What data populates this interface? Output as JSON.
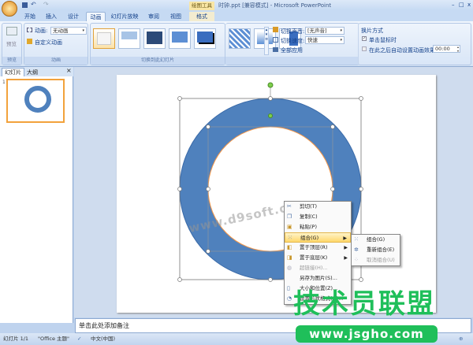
{
  "title": {
    "filename": "时钟.ppt [兼容模式] - Microsoft PowerPoint",
    "context_tool": "绘图工具",
    "window_controls": [
      "–",
      "□",
      "x"
    ]
  },
  "tabs": [
    {
      "label": "开始"
    },
    {
      "label": "插入"
    },
    {
      "label": "设计"
    },
    {
      "label": "动画",
      "active": true
    },
    {
      "label": "幻灯片放映"
    },
    {
      "label": "审阅"
    },
    {
      "label": "视图"
    },
    {
      "label": "格式"
    }
  ],
  "ribbon": {
    "preview": {
      "button": "预览",
      "group": "预览"
    },
    "animation": {
      "label": "动画:",
      "value": "无动画",
      "custom": "自定义动画",
      "group": "动画"
    },
    "transition": {
      "sound_label": "切换声音:",
      "sound_value": "[无声音]",
      "speed_label": "切换速度:",
      "speed_value": "快速",
      "apply_all": "全部应用",
      "group": "切换到此幻灯片"
    },
    "advance": {
      "title": "换片方式",
      "on_click": "单击鼠标时",
      "on_click_checked": true,
      "after": "在此之后自动设置动画效果:",
      "after_checked": false,
      "time": "00:00"
    }
  },
  "left_pane": {
    "tab_slides": "幻灯片",
    "tab_outline": "大纲",
    "close": "×",
    "slide_number": "1"
  },
  "context_menu": {
    "items": [
      {
        "label": "剪切(T)",
        "icon": "scissors-icon"
      },
      {
        "label": "复制(C)",
        "icon": "copy-icon"
      },
      {
        "label": "粘贴(P)",
        "icon": "paste-icon"
      },
      {
        "label": "组合(G)",
        "icon": "group-icon",
        "submenu": true,
        "highlighted": true
      },
      {
        "label": "置于顶层(R)",
        "icon": "bring-front-icon",
        "submenu": true
      },
      {
        "label": "置于底层(K)",
        "icon": "send-back-icon",
        "submenu": true
      },
      {
        "label": "超链接(H)...",
        "icon": "hyperlink-icon",
        "disabled": true
      },
      {
        "label": "另存为图片(S)...",
        "icon": ""
      },
      {
        "label": "大小和位置(Z)...",
        "icon": "size-icon"
      },
      {
        "label": "设置形状格式(O)...",
        "icon": "format-shape-icon"
      }
    ],
    "submenu": [
      {
        "label": "组合(G)",
        "icon": "group-icon"
      },
      {
        "label": "重新组合(E)",
        "icon": "regroup-icon"
      },
      {
        "label": "取消组合(U)",
        "icon": "ungroup-icon",
        "disabled": true
      }
    ]
  },
  "notes_placeholder": "单击此处添加备注",
  "status": {
    "slide": "幻灯片 1/1",
    "theme": "\"Office 主题\"",
    "language": "中文(中国)"
  },
  "watermarks": {
    "d9soft": "www.d9soft.com",
    "brand": "技术员联盟",
    "url": "www.jsgho.com"
  },
  "colors": {
    "ring_fill": "#4f81bd",
    "inner_outline": "#f79646",
    "watermark_green": "#1fbf5a",
    "highlight": "#ffd86c"
  }
}
